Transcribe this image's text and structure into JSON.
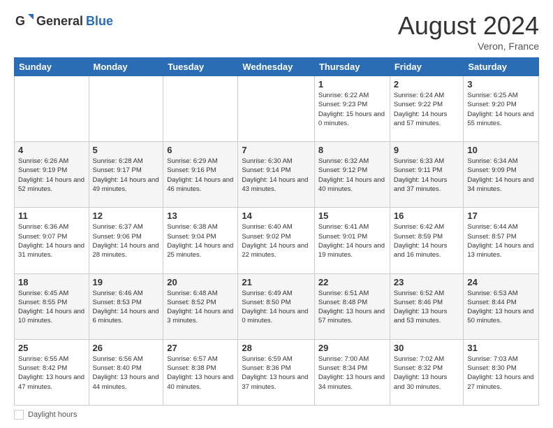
{
  "logo": {
    "general": "General",
    "blue": "Blue"
  },
  "header": {
    "month_year": "August 2024",
    "location": "Veron, France"
  },
  "days_of_week": [
    "Sunday",
    "Monday",
    "Tuesday",
    "Wednesday",
    "Thursday",
    "Friday",
    "Saturday"
  ],
  "weeks": [
    [
      {
        "day": "",
        "info": ""
      },
      {
        "day": "",
        "info": ""
      },
      {
        "day": "",
        "info": ""
      },
      {
        "day": "",
        "info": ""
      },
      {
        "day": "1",
        "info": "Sunrise: 6:22 AM\nSunset: 9:23 PM\nDaylight: 15 hours and 0 minutes."
      },
      {
        "day": "2",
        "info": "Sunrise: 6:24 AM\nSunset: 9:22 PM\nDaylight: 14 hours and 57 minutes."
      },
      {
        "day": "3",
        "info": "Sunrise: 6:25 AM\nSunset: 9:20 PM\nDaylight: 14 hours and 55 minutes."
      }
    ],
    [
      {
        "day": "4",
        "info": "Sunrise: 6:26 AM\nSunset: 9:19 PM\nDaylight: 14 hours and 52 minutes."
      },
      {
        "day": "5",
        "info": "Sunrise: 6:28 AM\nSunset: 9:17 PM\nDaylight: 14 hours and 49 minutes."
      },
      {
        "day": "6",
        "info": "Sunrise: 6:29 AM\nSunset: 9:16 PM\nDaylight: 14 hours and 46 minutes."
      },
      {
        "day": "7",
        "info": "Sunrise: 6:30 AM\nSunset: 9:14 PM\nDaylight: 14 hours and 43 minutes."
      },
      {
        "day": "8",
        "info": "Sunrise: 6:32 AM\nSunset: 9:12 PM\nDaylight: 14 hours and 40 minutes."
      },
      {
        "day": "9",
        "info": "Sunrise: 6:33 AM\nSunset: 9:11 PM\nDaylight: 14 hours and 37 minutes."
      },
      {
        "day": "10",
        "info": "Sunrise: 6:34 AM\nSunset: 9:09 PM\nDaylight: 14 hours and 34 minutes."
      }
    ],
    [
      {
        "day": "11",
        "info": "Sunrise: 6:36 AM\nSunset: 9:07 PM\nDaylight: 14 hours and 31 minutes."
      },
      {
        "day": "12",
        "info": "Sunrise: 6:37 AM\nSunset: 9:06 PM\nDaylight: 14 hours and 28 minutes."
      },
      {
        "day": "13",
        "info": "Sunrise: 6:38 AM\nSunset: 9:04 PM\nDaylight: 14 hours and 25 minutes."
      },
      {
        "day": "14",
        "info": "Sunrise: 6:40 AM\nSunset: 9:02 PM\nDaylight: 14 hours and 22 minutes."
      },
      {
        "day": "15",
        "info": "Sunrise: 6:41 AM\nSunset: 9:01 PM\nDaylight: 14 hours and 19 minutes."
      },
      {
        "day": "16",
        "info": "Sunrise: 6:42 AM\nSunset: 8:59 PM\nDaylight: 14 hours and 16 minutes."
      },
      {
        "day": "17",
        "info": "Sunrise: 6:44 AM\nSunset: 8:57 PM\nDaylight: 14 hours and 13 minutes."
      }
    ],
    [
      {
        "day": "18",
        "info": "Sunrise: 6:45 AM\nSunset: 8:55 PM\nDaylight: 14 hours and 10 minutes."
      },
      {
        "day": "19",
        "info": "Sunrise: 6:46 AM\nSunset: 8:53 PM\nDaylight: 14 hours and 6 minutes."
      },
      {
        "day": "20",
        "info": "Sunrise: 6:48 AM\nSunset: 8:52 PM\nDaylight: 14 hours and 3 minutes."
      },
      {
        "day": "21",
        "info": "Sunrise: 6:49 AM\nSunset: 8:50 PM\nDaylight: 14 hours and 0 minutes."
      },
      {
        "day": "22",
        "info": "Sunrise: 6:51 AM\nSunset: 8:48 PM\nDaylight: 13 hours and 57 minutes."
      },
      {
        "day": "23",
        "info": "Sunrise: 6:52 AM\nSunset: 8:46 PM\nDaylight: 13 hours and 53 minutes."
      },
      {
        "day": "24",
        "info": "Sunrise: 6:53 AM\nSunset: 8:44 PM\nDaylight: 13 hours and 50 minutes."
      }
    ],
    [
      {
        "day": "25",
        "info": "Sunrise: 6:55 AM\nSunset: 8:42 PM\nDaylight: 13 hours and 47 minutes."
      },
      {
        "day": "26",
        "info": "Sunrise: 6:56 AM\nSunset: 8:40 PM\nDaylight: 13 hours and 44 minutes."
      },
      {
        "day": "27",
        "info": "Sunrise: 6:57 AM\nSunset: 8:38 PM\nDaylight: 13 hours and 40 minutes."
      },
      {
        "day": "28",
        "info": "Sunrise: 6:59 AM\nSunset: 8:36 PM\nDaylight: 13 hours and 37 minutes."
      },
      {
        "day": "29",
        "info": "Sunrise: 7:00 AM\nSunset: 8:34 PM\nDaylight: 13 hours and 34 minutes."
      },
      {
        "day": "30",
        "info": "Sunrise: 7:02 AM\nSunset: 8:32 PM\nDaylight: 13 hours and 30 minutes."
      },
      {
        "day": "31",
        "info": "Sunrise: 7:03 AM\nSunset: 8:30 PM\nDaylight: 13 hours and 27 minutes."
      }
    ]
  ],
  "legend": {
    "label": "Daylight hours"
  }
}
